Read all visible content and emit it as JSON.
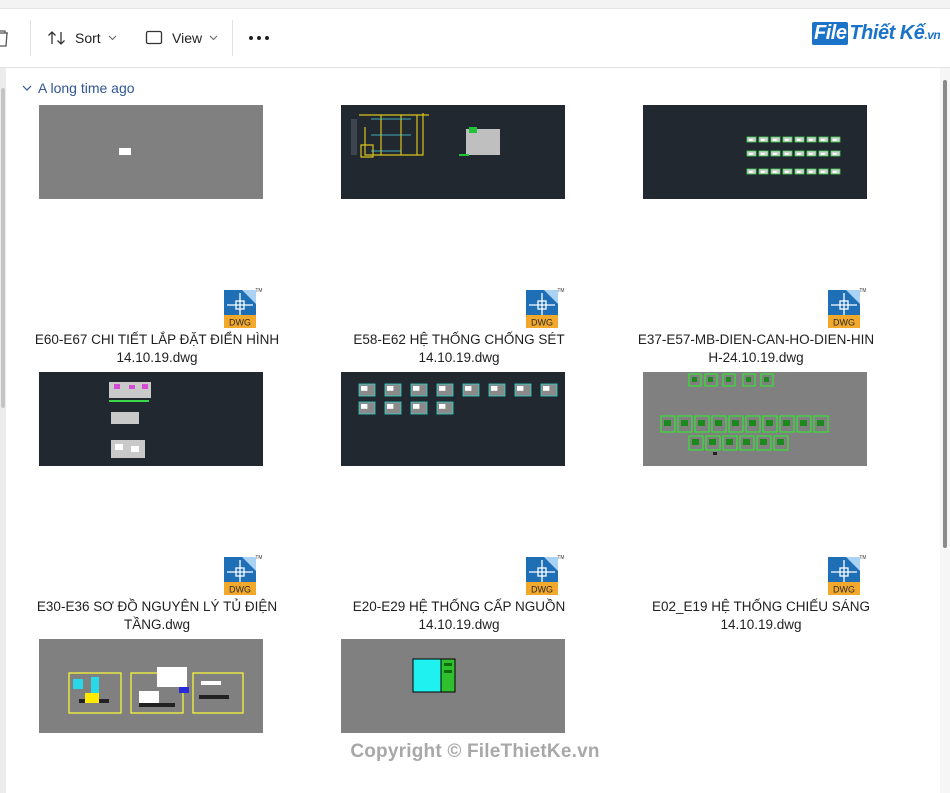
{
  "toolbar": {
    "sort_label": "Sort",
    "view_label": "View",
    "more_label": "..."
  },
  "logo": {
    "box": "File",
    "text": "Thiết Kế",
    "tld": ".vn"
  },
  "group": {
    "title": "A long time ago"
  },
  "files": [
    {
      "name_line1": "E60-E67 CHI TIẾT LẮP ĐẶT ĐIỂN HÌNH",
      "name_line2": "14.10.19.dwg"
    },
    {
      "name_line1": "E58-E62 HỆ THỐNG CHỐNG SÉT",
      "name_line2": "14.10.19.dwg"
    },
    {
      "name_line1": "E37-E57-MB-DIEN-CAN-HO-DIEN-HIN",
      "name_line2": "H-24.10.19.dwg"
    },
    {
      "name_line1": "E30-E36 SƠ ĐỒ NGUYÊN LÝ TỦ ĐIỆN",
      "name_line2": "TẦNG.dwg"
    },
    {
      "name_line1": "E20-E29 HỆ THỐNG CẤP NGUỒN",
      "name_line2": "14.10.19.dwg"
    },
    {
      "name_line1": "E02_E19 HỆ THỐNG CHIẾU SÁNG",
      "name_line2": "14.10.19.dwg"
    }
  ],
  "file_badge": {
    "dwg": "DWG",
    "tm": "TM"
  },
  "watermark": {
    "text": "Copyright © FileThietKe.vn"
  },
  "colors": {
    "cad_dark": "#212830",
    "cad_gray": "#808080",
    "group_text": "#2f5597",
    "dwg_blue": "#1f6fb7",
    "dwg_orange": "#f2a82b"
  }
}
